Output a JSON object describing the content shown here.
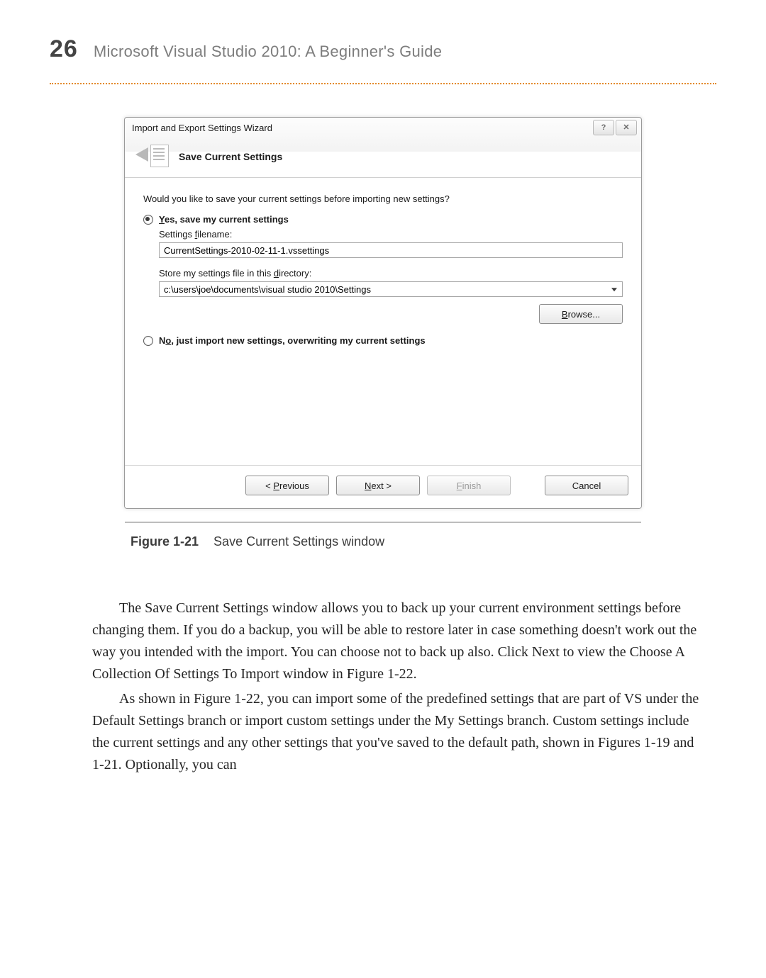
{
  "page": {
    "number": "26",
    "book_title": "Microsoft Visual Studio 2010: A Beginner's Guide"
  },
  "window": {
    "title": "Import and Export Settings Wizard",
    "help_glyph": "?",
    "close_glyph": "✕",
    "section_title": "Save Current Settings",
    "prompt": "Would you like to save your current settings before importing new settings?",
    "opt_yes": {
      "prefix_u": "Y",
      "rest": "es, save my current settings"
    },
    "filename_label": {
      "pre": "Settings ",
      "u": "f",
      "post": "ilename:"
    },
    "filename_value": "CurrentSettings-2010-02-11-1.vssettings",
    "dir_label": {
      "pre": "Store my settings file in this ",
      "u": "d",
      "post": "irectory:"
    },
    "dir_value": "c:\\users\\joe\\documents\\visual studio 2010\\Settings",
    "browse": {
      "u": "B",
      "rest": "rowse..."
    },
    "opt_no": {
      "pre": "N",
      "u": "o",
      "post": ", just import new settings, overwriting my current settings"
    },
    "buttons": {
      "prev": {
        "lt": "< ",
        "u": "P",
        "rest": "revious"
      },
      "next": {
        "u": "N",
        "rest": "ext >"
      },
      "finish": {
        "u": "F",
        "rest": "inish"
      },
      "cancel": {
        "text": "Cancel"
      }
    }
  },
  "caption": {
    "label": "Figure 1-21",
    "text": "Save Current Settings window"
  },
  "paragraphs": {
    "p1": "The Save Current Settings window allows you to back up your current environment settings before changing them. If you do a backup, you will be able to restore later in case something doesn't work out the way you intended with the import. You can choose not to back up also. Click Next to view the Choose A Collection Of Settings To Import window in Figure 1-22.",
    "p2": "As shown in Figure 1-22, you can import some of the predefined settings that are part of VS under the Default Settings branch or import custom settings under the My Settings branch. Custom settings include the current settings and any other settings that you've saved to the default path, shown in Figures 1-19 and 1-21. Optionally, you can"
  }
}
